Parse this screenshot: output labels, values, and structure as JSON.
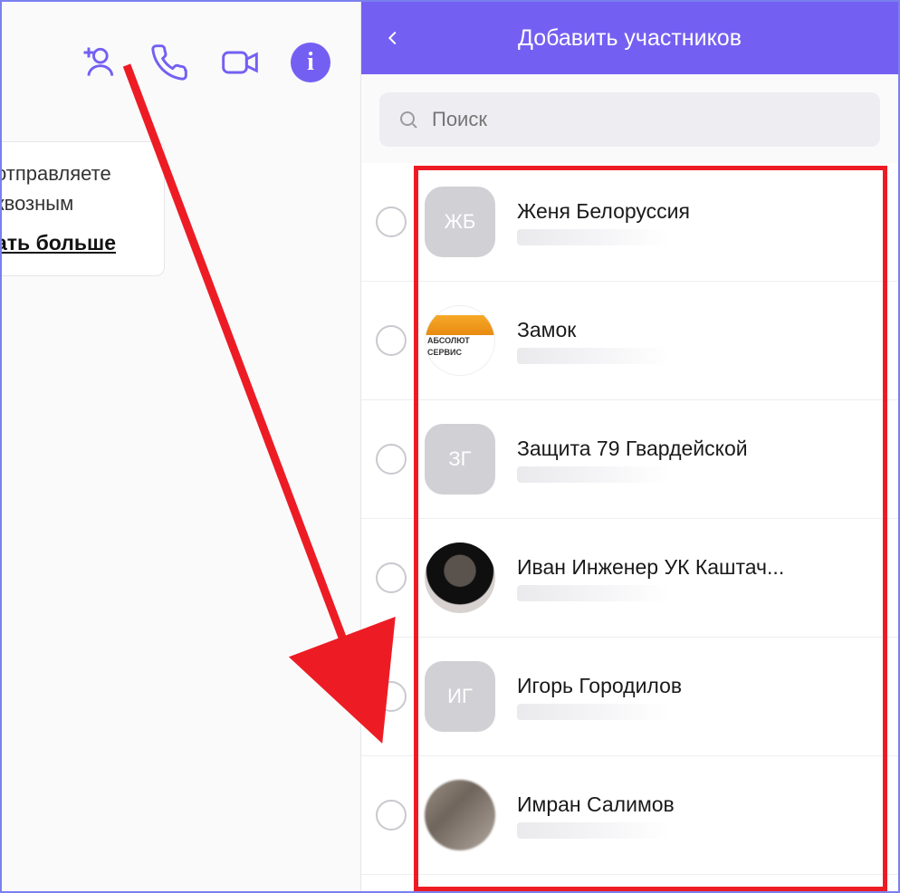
{
  "left": {
    "msg_line1": "отправляете",
    "msg_line2": "квозным",
    "msg_more": "ать больше"
  },
  "header": {
    "title": "Добавить участников"
  },
  "search": {
    "placeholder": "Поиск"
  },
  "contacts": [
    {
      "name": "Женя Белоруссия",
      "avatar_type": "initials",
      "initials": "ЖБ",
      "round": false
    },
    {
      "name": "Замок",
      "avatar_type": "abs",
      "initials": "",
      "round": true,
      "abs_t1": "АБСОЛЮТ",
      "abs_t2": "СЕРВИС"
    },
    {
      "name": "Защита 79 Гвардейской",
      "avatar_type": "initials",
      "initials": "ЗГ",
      "round": false
    },
    {
      "name": "Иван Инженер УК Каштач...",
      "avatar_type": "photo1",
      "initials": "",
      "round": true
    },
    {
      "name": "Игорь Городилов",
      "avatar_type": "initials",
      "initials": "ИГ",
      "round": false
    },
    {
      "name": "Имран Салимов",
      "avatar_type": "photo2",
      "initials": "",
      "round": true
    }
  ],
  "colors": {
    "accent": "#7360f2",
    "highlight": "#ed1c24"
  }
}
